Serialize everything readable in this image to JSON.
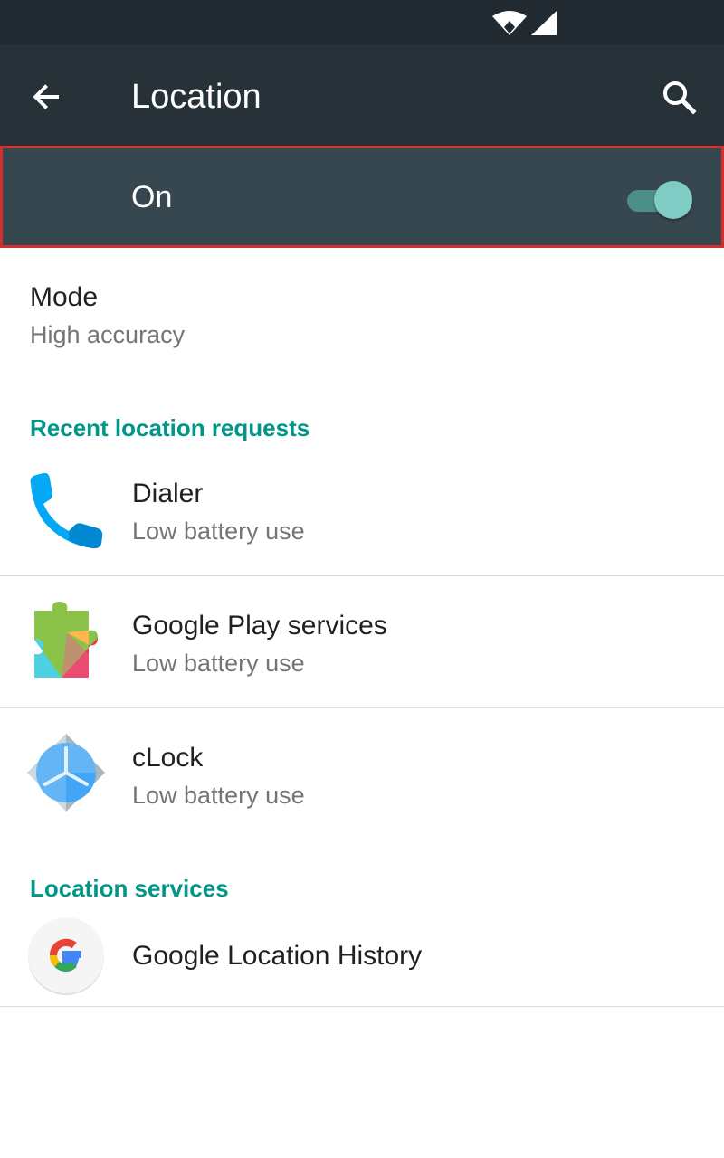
{
  "status_bar": {
    "icons": [
      "wifi-icon",
      "cell-signal-icon"
    ]
  },
  "app_bar": {
    "title": "Location",
    "back_icon": "arrow-back-icon",
    "search_icon": "search-icon"
  },
  "master_switch": {
    "label": "On",
    "state": true
  },
  "mode": {
    "title": "Mode",
    "value": "High accuracy"
  },
  "recent_requests": {
    "header": "Recent location requests",
    "items": [
      {
        "name": "Dialer",
        "usage": "Low battery use",
        "icon": "phone-icon"
      },
      {
        "name": "Google Play services",
        "usage": "Low battery use",
        "icon": "puzzle-icon"
      },
      {
        "name": "cLock",
        "usage": "Low battery use",
        "icon": "clock-icon"
      }
    ]
  },
  "location_services": {
    "header": "Location services",
    "items": [
      {
        "name": "Google Location History",
        "icon": "google-g-icon"
      }
    ]
  },
  "colors": {
    "accent": "#009688",
    "app_bar": "#263238",
    "switch_bar": "#37474f",
    "highlight_border": "#d32f2f"
  }
}
